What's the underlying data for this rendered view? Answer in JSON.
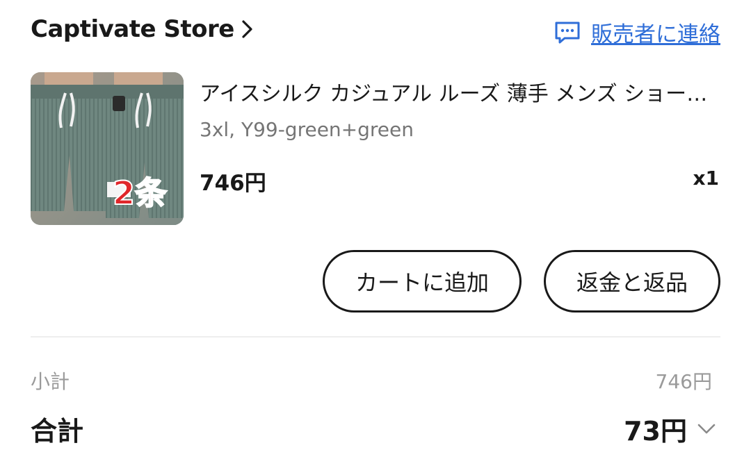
{
  "store": {
    "name": "Captivate Store",
    "contact_label": "販売者に連絡"
  },
  "product": {
    "title": "アイスシルク カジュアル ルーズ 薄手 メンズ ショートパンツ",
    "variant": "3xl, Y99-green+green",
    "price": "746円",
    "quantity": "x1",
    "image_badge": "2条"
  },
  "actions": {
    "add_to_cart": "カートに追加",
    "refund_return": "返金と返品"
  },
  "summary": {
    "subtotal_label": "小計",
    "subtotal_value": "746円",
    "total_label": "合計",
    "total_value": "73円"
  },
  "colors": {
    "link": "#2f6ed8",
    "text": "#191919",
    "muted": "#9a9a9a"
  },
  "icons": {
    "store_chevron": "chevron-right-icon",
    "contact": "chat-icon",
    "total_toggle": "chevron-down-icon"
  }
}
